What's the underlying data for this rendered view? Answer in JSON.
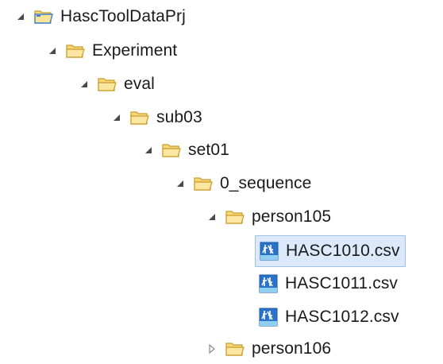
{
  "tree": {
    "project": {
      "label": "HascToolDataPrj",
      "icon": "project-folder-icon",
      "expanded": true
    },
    "folders": [
      {
        "label": "Experiment",
        "icon": "open-folder-icon",
        "expanded": true
      },
      {
        "label": "eval",
        "icon": "open-folder-icon",
        "expanded": true
      },
      {
        "label": "sub03",
        "icon": "open-folder-icon",
        "expanded": true
      },
      {
        "label": "set01",
        "icon": "open-folder-icon",
        "expanded": true
      },
      {
        "label": "0_sequence",
        "icon": "open-folder-icon",
        "expanded": true
      },
      {
        "label": "person105",
        "icon": "open-folder-icon",
        "expanded": true
      }
    ],
    "files": [
      {
        "label": "HASC1010.csv",
        "icon": "hasc-file-icon",
        "selected": true
      },
      {
        "label": "HASC1011.csv",
        "icon": "hasc-file-icon",
        "selected": false
      },
      {
        "label": "HASC1012.csv",
        "icon": "hasc-file-icon",
        "selected": false
      }
    ],
    "collapsed_folder": {
      "label": "person106",
      "icon": "open-folder-icon",
      "expanded": false
    }
  },
  "colors": {
    "folder_fill": "#f7d978",
    "folder_stroke": "#c99a2a",
    "project_blue": "#3f7fd2",
    "twisty": "#4a4a4a",
    "file_icon_bg": "#2a73c8",
    "selection_bg": "#dbe9fb",
    "selection_border": "#9ec4ee"
  }
}
